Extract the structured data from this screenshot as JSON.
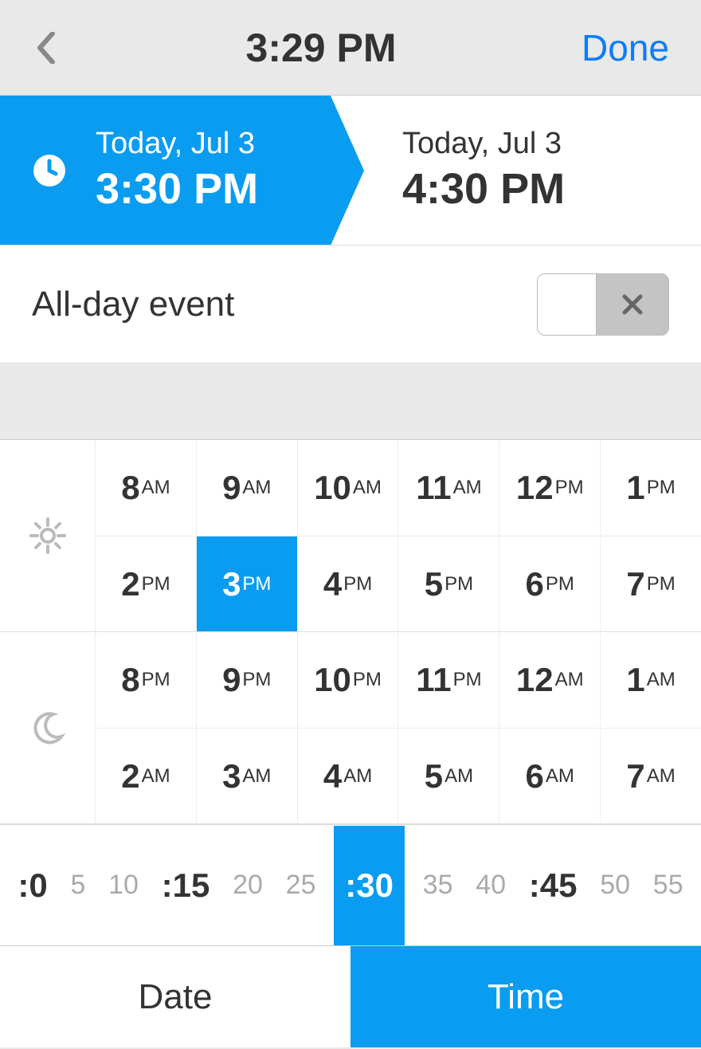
{
  "header": {
    "title": "3:29 PM",
    "done_label": "Done"
  },
  "range": {
    "start": {
      "date": "Today, Jul 3",
      "time": "3:30 PM"
    },
    "end": {
      "date": "Today, Jul 3",
      "time": "4:30 PM"
    }
  },
  "allday": {
    "label": "All-day event",
    "state": "off"
  },
  "hours": {
    "day_rows": [
      [
        {
          "n": "8",
          "s": "AM"
        },
        {
          "n": "9",
          "s": "AM"
        },
        {
          "n": "10",
          "s": "AM"
        },
        {
          "n": "11",
          "s": "AM"
        },
        {
          "n": "12",
          "s": "PM"
        },
        {
          "n": "1",
          "s": "PM"
        }
      ],
      [
        {
          "n": "2",
          "s": "PM"
        },
        {
          "n": "3",
          "s": "PM",
          "sel": true
        },
        {
          "n": "4",
          "s": "PM"
        },
        {
          "n": "5",
          "s": "PM"
        },
        {
          "n": "6",
          "s": "PM"
        },
        {
          "n": "7",
          "s": "PM"
        }
      ]
    ],
    "night_rows": [
      [
        {
          "n": "8",
          "s": "PM"
        },
        {
          "n": "9",
          "s": "PM"
        },
        {
          "n": "10",
          "s": "PM"
        },
        {
          "n": "11",
          "s": "PM"
        },
        {
          "n": "12",
          "s": "AM"
        },
        {
          "n": "1",
          "s": "AM"
        }
      ],
      [
        {
          "n": "2",
          "s": "AM"
        },
        {
          "n": "3",
          "s": "AM"
        },
        {
          "n": "4",
          "s": "AM"
        },
        {
          "n": "5",
          "s": "AM"
        },
        {
          "n": "6",
          "s": "AM"
        },
        {
          "n": "7",
          "s": "AM"
        }
      ]
    ]
  },
  "minutes": [
    {
      "label": ":0",
      "major": true
    },
    {
      "label": "5"
    },
    {
      "label": "10"
    },
    {
      "label": ":15",
      "major": true
    },
    {
      "label": "20"
    },
    {
      "label": "25"
    },
    {
      "label": ":30",
      "major": true,
      "sel": true
    },
    {
      "label": "35"
    },
    {
      "label": "40"
    },
    {
      "label": ":45",
      "major": true
    },
    {
      "label": "50"
    },
    {
      "label": "55"
    }
  ],
  "tabs": {
    "date_label": "Date",
    "time_label": "Time",
    "selected": "time"
  }
}
